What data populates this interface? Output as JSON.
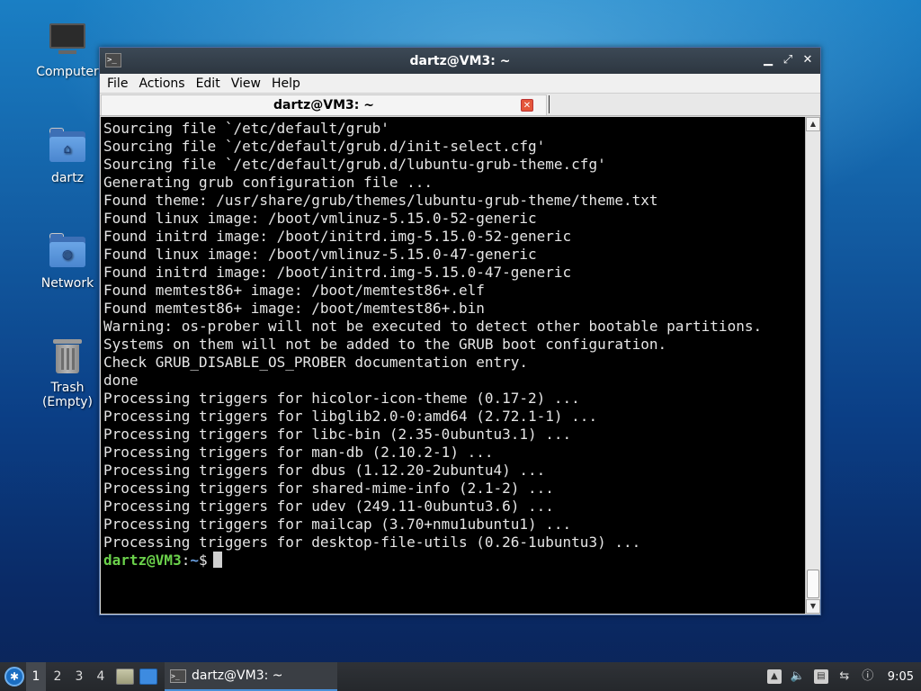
{
  "desktop": {
    "icons": [
      {
        "label": "Computer"
      },
      {
        "label": "dartz"
      },
      {
        "label": "Network"
      },
      {
        "label": "Trash (Empty)"
      }
    ]
  },
  "window": {
    "title": "dartz@VM3: ~",
    "menu": [
      "File",
      "Actions",
      "Edit",
      "View",
      "Help"
    ],
    "tab_label": "dartz@VM3: ~",
    "tab_close": "✕"
  },
  "terminal": {
    "lines": [
      "Sourcing file `/etc/default/grub'",
      "Sourcing file `/etc/default/grub.d/init-select.cfg'",
      "Sourcing file `/etc/default/grub.d/lubuntu-grub-theme.cfg'",
      "Generating grub configuration file ...",
      "Found theme: /usr/share/grub/themes/lubuntu-grub-theme/theme.txt",
      "Found linux image: /boot/vmlinuz-5.15.0-52-generic",
      "Found initrd image: /boot/initrd.img-5.15.0-52-generic",
      "Found linux image: /boot/vmlinuz-5.15.0-47-generic",
      "Found initrd image: /boot/initrd.img-5.15.0-47-generic",
      "Found memtest86+ image: /boot/memtest86+.elf",
      "Found memtest86+ image: /boot/memtest86+.bin",
      "Warning: os-prober will not be executed to detect other bootable partitions.",
      "Systems on them will not be added to the GRUB boot configuration.",
      "Check GRUB_DISABLE_OS_PROBER documentation entry.",
      "done",
      "Processing triggers for hicolor-icon-theme (0.17-2) ...",
      "Processing triggers for libglib2.0-0:amd64 (2.72.1-1) ...",
      "Processing triggers for libc-bin (2.35-0ubuntu3.1) ...",
      "Processing triggers for man-db (2.10.2-1) ...",
      "Processing triggers for dbus (1.12.20-2ubuntu4) ...",
      "Processing triggers for shared-mime-info (2.1-2) ...",
      "Processing triggers for udev (249.11-0ubuntu3.6) ...",
      "Processing triggers for mailcap (3.70+nmu1ubuntu1) ...",
      "Processing triggers for desktop-file-utils (0.26-1ubuntu3) ..."
    ],
    "prompt_user": "dartz@VM3",
    "prompt_sep": ":",
    "prompt_path": "~",
    "prompt_symbol": "$"
  },
  "taskbar": {
    "workspaces": [
      "1",
      "2",
      "3",
      "4"
    ],
    "active_workspace": "1",
    "task_label": "dartz@VM3: ~",
    "clock": "9:05"
  }
}
